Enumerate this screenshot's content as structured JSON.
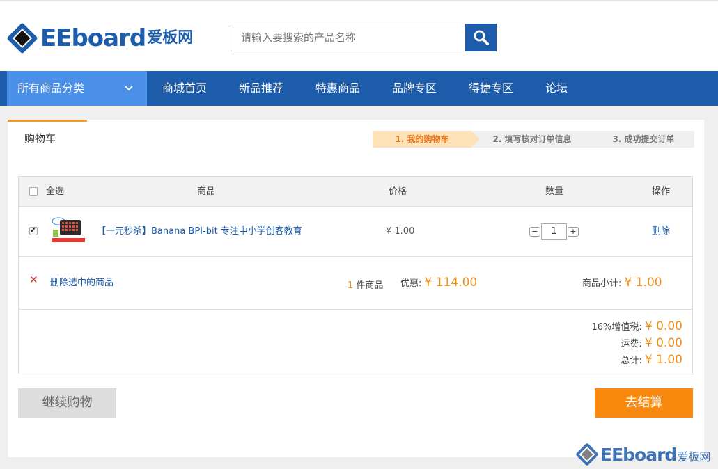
{
  "header": {
    "logo_text": "EEboard",
    "logo_cn": "爱板网",
    "search_placeholder": "请输入要搜索的产品名称"
  },
  "nav": {
    "all_categories": "所有商品分类",
    "items": [
      "商城首页",
      "新品推荐",
      "特惠商品",
      "品牌专区",
      "得捷专区",
      "论坛"
    ]
  },
  "cart": {
    "tab_label": "购物车",
    "steps": [
      "1. 我的购物车",
      "2. 填写核对订单信息",
      "3. 成功提交订单"
    ],
    "headers": {
      "select_all": "全选",
      "product": "商品",
      "price": "价格",
      "quantity": "数量",
      "action": "操作"
    },
    "item": {
      "name": "【一元秒杀】Banana BPI-bit 专注中小学创客教育",
      "price": "¥ 1.00",
      "quantity": "1",
      "minus": "−",
      "plus": "+",
      "delete_label": "删除",
      "checked": true
    },
    "summary": {
      "delete_selected": "删除选中的商品",
      "count": "1",
      "count_suffix": "件商品",
      "discount_label": "优惠:",
      "discount_value": "¥ 114.00",
      "subtotal_label": "商品小计:",
      "subtotal_value": "¥ 1.00"
    },
    "totals": {
      "tax_label": "16%增值税:",
      "tax_value": "¥ 0.00",
      "shipping_label": "运费:",
      "shipping_value": "¥ 0.00",
      "total_label": "总计:",
      "total_value": "¥ 1.00"
    },
    "continue_label": "继续购物",
    "checkout_label": "去结算"
  },
  "watermark": {
    "text": "EEboard",
    "cn": "爱板网"
  },
  "colors": {
    "brand_blue": "#1d5caa",
    "nav_highlight": "#4a8fe8",
    "accent_orange": "#f7890f",
    "step_active_bg": "#fde2b7"
  }
}
